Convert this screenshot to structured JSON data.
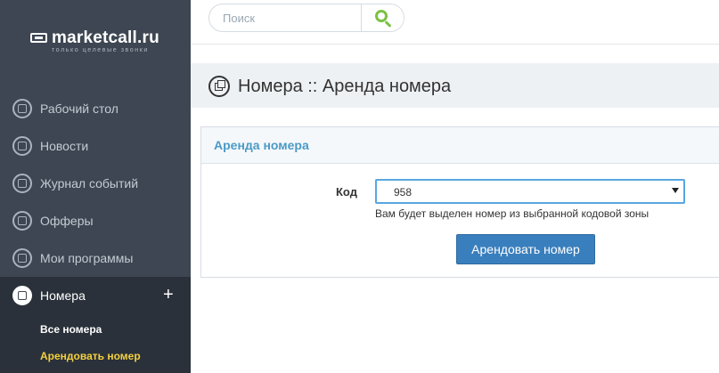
{
  "brand": {
    "name": "marketcall.ru",
    "tagline": "только целевые звонки"
  },
  "search": {
    "placeholder": "Поиск",
    "button_icon": "search-icon"
  },
  "sidebar": {
    "items": [
      {
        "label": "Рабочий стол",
        "icon": "desktop-icon"
      },
      {
        "label": "Новости",
        "icon": "news-icon"
      },
      {
        "label": "Журнал событий",
        "icon": "log-icon"
      },
      {
        "label": "Офферы",
        "icon": "offers-icon"
      },
      {
        "label": "Мои программы",
        "icon": "programs-icon"
      },
      {
        "label": "Номера",
        "icon": "numbers-icon",
        "active": true,
        "expand_symbol": "+"
      }
    ],
    "subitems": [
      {
        "label": "Все номера"
      },
      {
        "label": "Арендовать номер",
        "current": true
      }
    ]
  },
  "page": {
    "title": "Номера :: Аренда номера",
    "icon": "numbers-icon"
  },
  "panel": {
    "title": "Аренда номера",
    "field_label": "Код",
    "select_value": "958",
    "help_text": "Вам будет выделен номер из выбранной кодовой зоны",
    "submit_label": "Арендовать номер"
  },
  "colors": {
    "sidebar_bg": "#3d4652",
    "sidebar_active_bg": "#2a313a",
    "accent_yellow": "#f4d03f",
    "search_green": "#7cc142",
    "panel_title_blue": "#4a9bc7",
    "button_blue": "#3a7fbd"
  }
}
